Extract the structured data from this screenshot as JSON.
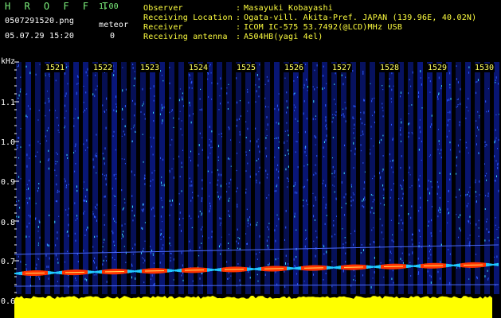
{
  "header": {
    "app_title": "H R O F F T",
    "app_version": "1.00",
    "file_name": "0507291520.png",
    "datetime": "05.07.29 15:20",
    "meteor_label": "meteor",
    "meteor_count": "0",
    "info": [
      {
        "label": "Observer",
        "value": "Masayuki Kobayashi"
      },
      {
        "label": "Receiving Location",
        "value": "Ogata-vill. Akita-Pref. JAPAN (139.96E, 40.02N)"
      },
      {
        "label": "Receiver",
        "value": "ICOM IC-575 53.7492(@LCD)MHz USB"
      },
      {
        "label": "Receiving antenna",
        "value": "A504HB(yagi 4el)"
      }
    ],
    "separator": ":"
  },
  "y_axis": {
    "unit": "kHz",
    "ticks": [
      "1.1",
      "1.0",
      "0.9",
      "0.8",
      "0.7",
      "0.6"
    ]
  },
  "time_axis": {
    "ticks": [
      "1521",
      "1522",
      "1523",
      "1524",
      "1525",
      "1526",
      "1527",
      "1528",
      "1529",
      "1530"
    ]
  },
  "colors": {
    "background": "#000000",
    "noise_floor": "#0a1a8c",
    "signal_line": "#ff3300",
    "power_bar": "#ffff00",
    "tick_text": "#ffff60",
    "header_green": "#7cf07c",
    "header_yellow": "#ffff40"
  }
}
